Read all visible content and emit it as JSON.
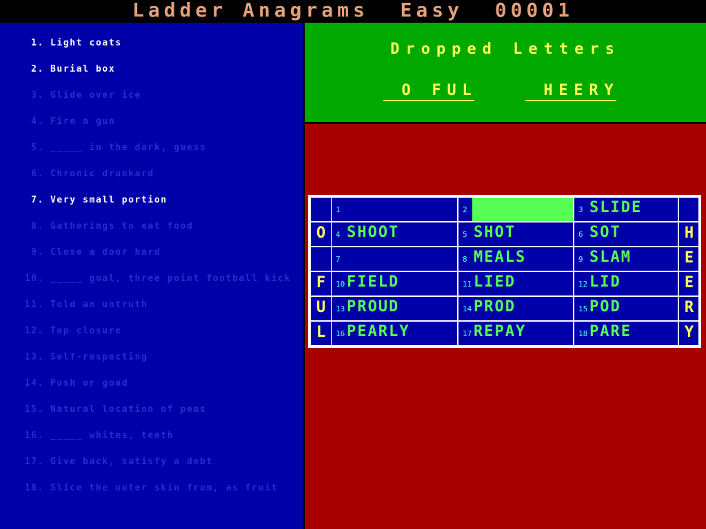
{
  "title": "Ladder Anagrams  Easy  00001",
  "dropped": {
    "heading": "Dropped Letters",
    "word1": [
      "_",
      "O",
      "_",
      "F",
      "U",
      "L"
    ],
    "word2": [
      "_",
      "H",
      "E",
      "E",
      "R",
      "Y"
    ]
  },
  "clues": [
    {
      "n": "1.",
      "t": "Light coats",
      "active": true
    },
    {
      "n": "2.",
      "t": "Burial box",
      "active": true
    },
    {
      "n": "3.",
      "t": "Glide over ice",
      "active": false
    },
    {
      "n": "4.",
      "t": "Fire a gun",
      "active": false
    },
    {
      "n": "5.",
      "t": "_____ in the dark, guess",
      "active": false
    },
    {
      "n": "6.",
      "t": "Chronic drunkard",
      "active": false
    },
    {
      "n": "7.",
      "t": "Very small portion",
      "active": true
    },
    {
      "n": "8.",
      "t": "Gatherings to eat food",
      "active": false
    },
    {
      "n": "9.",
      "t": "Close a door hard",
      "active": false
    },
    {
      "n": "10.",
      "t": "_____ goal, three point football kick",
      "active": false
    },
    {
      "n": "11.",
      "t": "Told an untruth",
      "active": false
    },
    {
      "n": "12.",
      "t": "Top closure",
      "active": false
    },
    {
      "n": "13.",
      "t": "Self-respecting",
      "active": false
    },
    {
      "n": "14.",
      "t": "Push or goad",
      "active": false
    },
    {
      "n": "15.",
      "t": "Natural location of peas",
      "active": false
    },
    {
      "n": "16.",
      "t": "_____ whites, teeth",
      "active": false
    },
    {
      "n": "17.",
      "t": "Give back, satisfy a debt",
      "active": false
    },
    {
      "n": "18.",
      "t": "Slice the outer skin from, as fruit",
      "active": false
    }
  ],
  "grid": {
    "rows": [
      {
        "left": "",
        "right": "",
        "cells": [
          {
            "num": "1",
            "word": "",
            "hl": false
          },
          {
            "num": "2",
            "word": "",
            "hl": true
          },
          {
            "num": "3",
            "word": "SLIDE",
            "hl": false
          }
        ]
      },
      {
        "left": "O",
        "right": "H",
        "cells": [
          {
            "num": "4",
            "word": "SHOOT",
            "hl": false
          },
          {
            "num": "5",
            "word": "SHOT",
            "hl": false
          },
          {
            "num": "6",
            "word": "SOT",
            "hl": false
          }
        ]
      },
      {
        "left": "",
        "right": "E",
        "cells": [
          {
            "num": "7",
            "word": "",
            "hl": false
          },
          {
            "num": "8",
            "word": "MEALS",
            "hl": false
          },
          {
            "num": "9",
            "word": "SLAM",
            "hl": false
          }
        ]
      },
      {
        "left": "F",
        "right": "E",
        "cells": [
          {
            "num": "10",
            "word": "FIELD",
            "hl": false
          },
          {
            "num": "11",
            "word": "LIED",
            "hl": false
          },
          {
            "num": "12",
            "word": "LID",
            "hl": false
          }
        ]
      },
      {
        "left": "U",
        "right": "R",
        "cells": [
          {
            "num": "13",
            "word": "PROUD",
            "hl": false
          },
          {
            "num": "14",
            "word": "PROD",
            "hl": false
          },
          {
            "num": "15",
            "word": "POD",
            "hl": false
          }
        ]
      },
      {
        "left": "L",
        "right": "Y",
        "cells": [
          {
            "num": "16",
            "word": "PEARLY",
            "hl": false
          },
          {
            "num": "17",
            "word": "REPAY",
            "hl": false
          },
          {
            "num": "18",
            "word": "PARE",
            "hl": false
          }
        ]
      }
    ]
  }
}
